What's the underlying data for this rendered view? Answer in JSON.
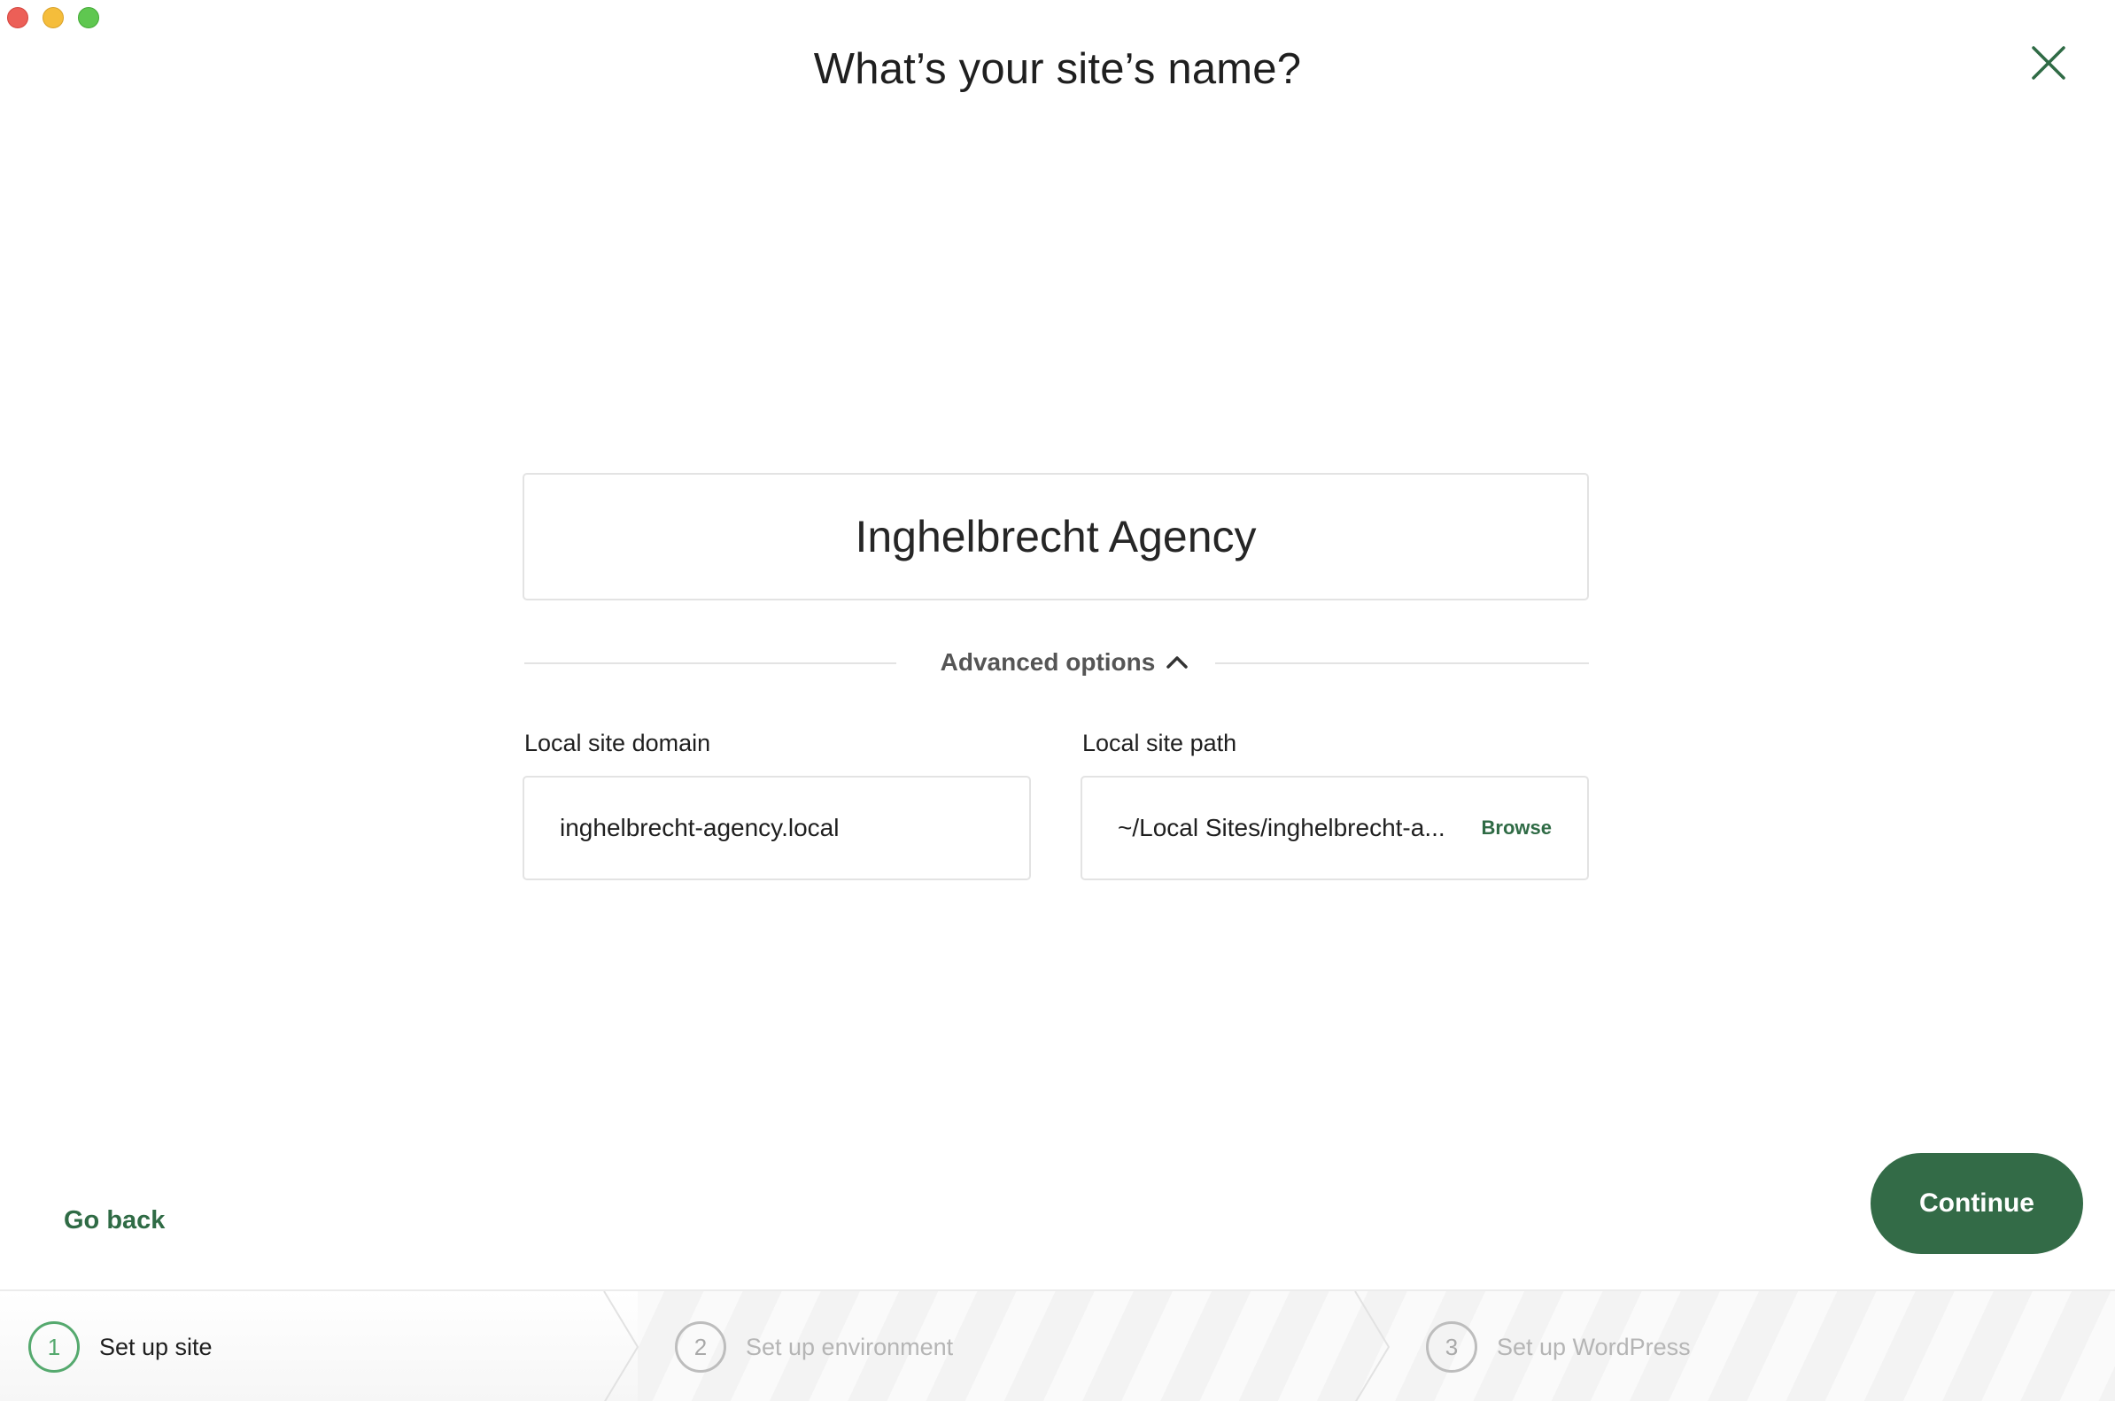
{
  "window": {
    "traffic_lights": [
      "close",
      "minimize",
      "maximize"
    ]
  },
  "header": {
    "title": "What’s your site’s name?",
    "close_icon": "close-x-icon"
  },
  "site_name": {
    "value": "Inghelbrecht Agency"
  },
  "advanced": {
    "label": "Advanced options",
    "expanded": true,
    "icon": "chevron-up-icon"
  },
  "fields": {
    "domain_label": "Local site domain",
    "domain_value": "inghelbrecht-agency.local",
    "path_label": "Local site path",
    "path_value": "~/Local Sites/inghelbrecht-a...",
    "browse_label": "Browse"
  },
  "footer": {
    "go_back": "Go back",
    "continue": "Continue"
  },
  "stepper": {
    "steps": [
      {
        "num": "1",
        "label": "Set up site",
        "active": true
      },
      {
        "num": "2",
        "label": "Set up environment",
        "active": false
      },
      {
        "num": "3",
        "label": "Set up WordPress",
        "active": false
      }
    ]
  },
  "colors": {
    "accent": "#336b47",
    "link": "#2f6b45",
    "step_active": "#55a96e"
  }
}
